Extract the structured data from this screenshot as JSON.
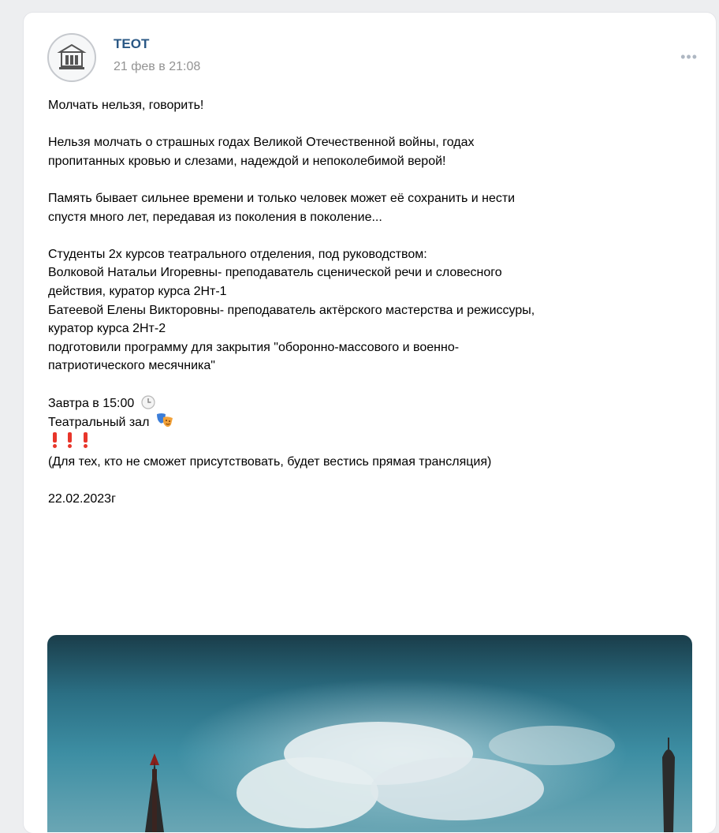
{
  "post": {
    "author": "ТЕОТ",
    "date": "21 фев в 21:08",
    "more_label": "•••",
    "lines": {
      "l1": "Молчать нельзя, говорить!",
      "l2": "Нельзя молчать о страшных годах Великой Отечественной войны, годах",
      "l3": "пропитанных кровью и слезами, надеждой и непоколебимой верой!",
      "l4": "Память бывает сильнее времени и только человек может её сохранить и нести",
      "l5": "спустя много лет, передавая из поколения в поколение...",
      "l6": "Студенты 2х курсов театрального отделения, под руководством:",
      "l7": "Волковой Натальи Игоревны- преподаватель сценической речи и словесного",
      "l8": "действия, куратор курса 2Нт-1",
      "l9": "Батеевой Елены Викторовны- преподаватель актёрского мастерства и режиссуры,",
      "l10": "куратор курса 2Нт-2",
      "l11": "подготовили программу для закрытия \"оборонно-массового и военно-",
      "l12": "патриотического месячника\"",
      "l13": "Завтра в 15:00",
      "l14": "Театральный зал",
      "l15": "(Для тех, кто не сможет присутствовать, будет вестись прямая трансляция)",
      "l16": "22.02.2023г"
    }
  },
  "colors": {
    "author": "#2a5885",
    "date": "#939393",
    "page_bg": "#edeef0",
    "exclamation": "#e8352a"
  },
  "icons": {
    "clock": "clock-icon",
    "theatre": "theatre-masks-icon",
    "exclamation": "red-exclamation-icon",
    "more": "more-icon"
  }
}
